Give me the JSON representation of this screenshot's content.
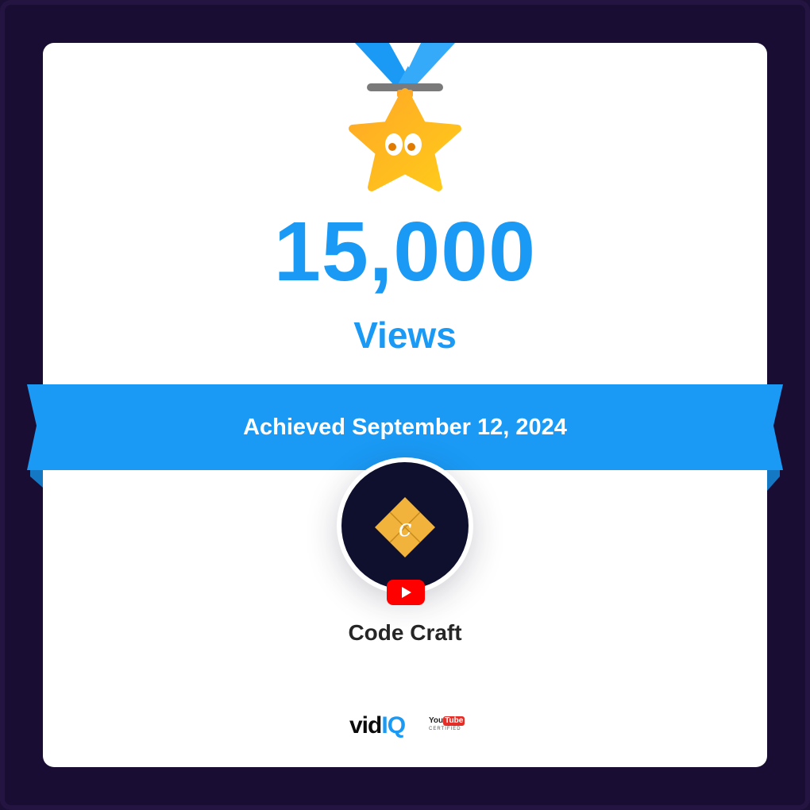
{
  "milestone": {
    "count": "15,000",
    "unit": "Views",
    "achieved": "Achieved September 12, 2024"
  },
  "channel": {
    "name": "Code Craft",
    "logo_letter": "c"
  },
  "brand": {
    "name_part1": "vid",
    "name_part2": "IQ",
    "youtube_you": "You",
    "youtube_tube": "Tube",
    "certified": "CERTIFIED"
  },
  "colors": {
    "accent": "#1a9af5",
    "frame": "#1a0d33",
    "medal": "#ffb020",
    "youtube": "#ff0000"
  },
  "icons": {
    "medal": "star-medal-icon",
    "play": "youtube-play-icon"
  }
}
